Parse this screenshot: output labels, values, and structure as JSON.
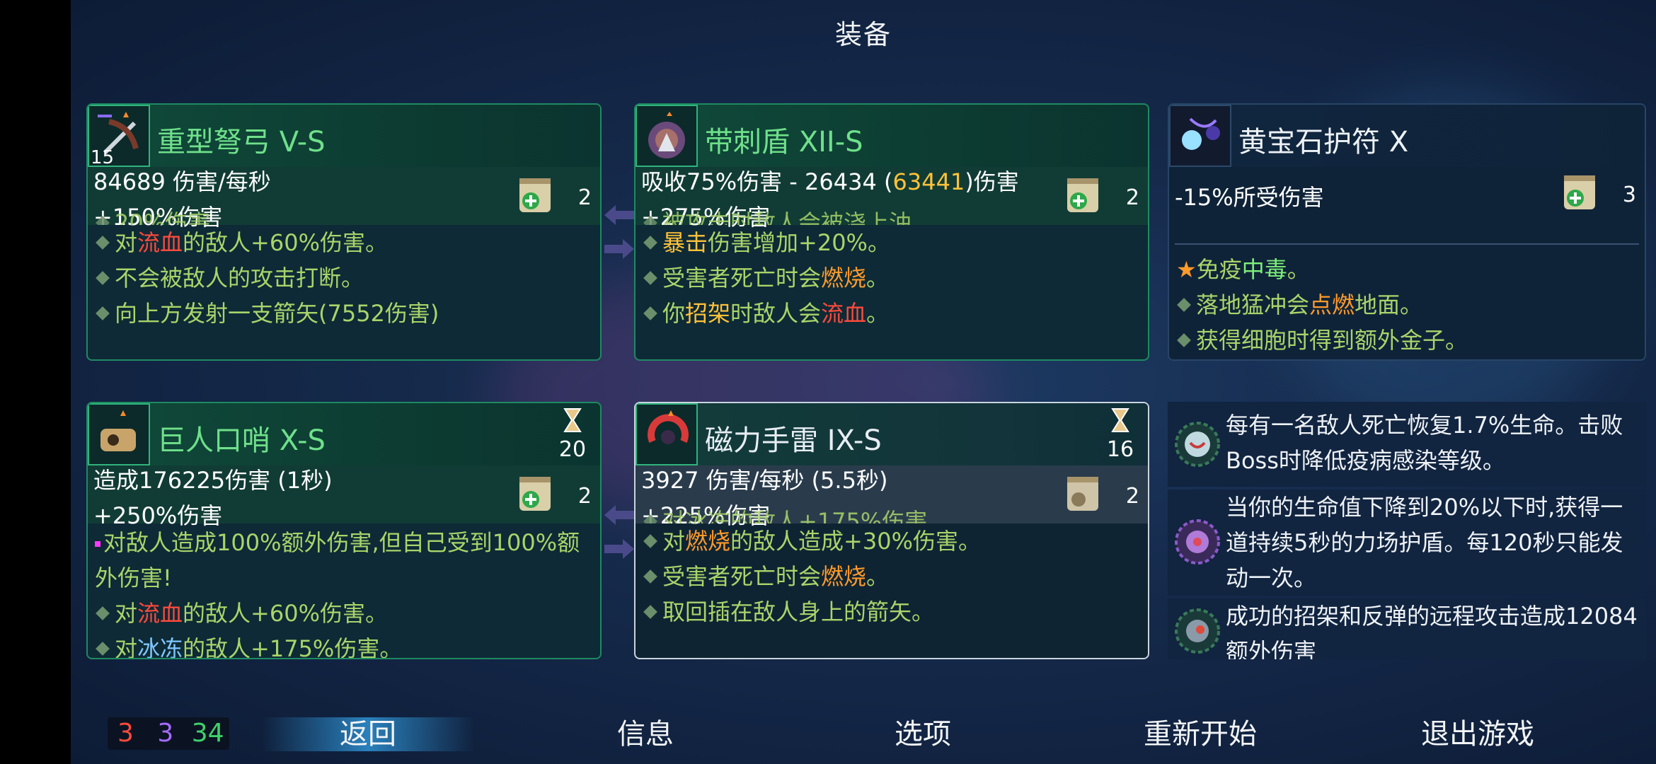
{
  "title": "装备",
  "weapons": [
    {
      "name": "重型弩弓 V-S",
      "level": "15",
      "line1": "84689 伤害/每秒",
      "line2": "+150%伤害",
      "scroll_count": "2",
      "cut_line": "20%伤害",
      "effects": [
        [
          {
            "t": "对"
          },
          {
            "t": "流血",
            "c": "r"
          },
          {
            "t": "的敌人+60%伤害。"
          }
        ],
        [
          {
            "t": "不会被敌人的攻击打断。"
          }
        ],
        [
          {
            "t": "向上方发射一支箭矢(7552伤害)"
          }
        ]
      ]
    },
    {
      "name": "带刺盾 XII-S",
      "line1_a": "吸收75%伤害 - 26434 (",
      "line1_b": "63441",
      "line1_c": ")伤害",
      "line2": "+275%伤害",
      "scroll_count": "2",
      "cut_line": "被攻击时敌人会被浇上油。",
      "effects": [
        [
          {
            "t": "暴击",
            "c": "y"
          },
          {
            "t": "伤害增加+20%。"
          }
        ],
        [
          {
            "t": "受害者死亡时会"
          },
          {
            "t": "燃烧",
            "c": "o"
          },
          {
            "t": "。"
          }
        ],
        [
          {
            "t": "你"
          },
          {
            "t": "招架",
            "c": "y"
          },
          {
            "t": "时敌人会"
          },
          {
            "t": "流血",
            "c": "r"
          },
          {
            "t": "。"
          }
        ]
      ]
    },
    {
      "name": "巨人口哨 X-S",
      "timer": "20",
      "line1": "造成176225伤害 (1秒)",
      "line2": "+250%伤害",
      "scroll_count": "2",
      "effects": [
        [
          {
            "t": "对敌人造成100%额外伤害,但自己受到100%额外伤害!"
          }
        ],
        [
          {
            "t": "对"
          },
          {
            "t": "流血",
            "c": "r"
          },
          {
            "t": "的敌人+60%伤害。"
          }
        ],
        [
          {
            "t": "对"
          },
          {
            "t": "冰冻",
            "c": "c"
          },
          {
            "t": "的敌人+175%伤害。"
          }
        ]
      ]
    },
    {
      "name": "磁力手雷 IX-S",
      "timer": "16",
      "line1": "3927 伤害/每秒 (5.5秒)",
      "line2": "+225%伤害",
      "scroll_count": "2",
      "cut_line": "对冰冻的敌人+175%伤害。",
      "effects": [
        [
          {
            "t": "对"
          },
          {
            "t": "燃烧",
            "c": "o"
          },
          {
            "t": "的敌人造成+30%伤害。"
          }
        ],
        [
          {
            "t": "受害者死亡时会"
          },
          {
            "t": "燃烧",
            "c": "o"
          },
          {
            "t": "。"
          }
        ],
        [
          {
            "t": "取回插在敌人身上的箭矢。"
          }
        ]
      ]
    }
  ],
  "amulet": {
    "name": "黄宝石护符 X",
    "line1": "-15%所受伤害",
    "scroll_count": "3",
    "effects": [
      [
        {
          "t": "免疫"
        },
        {
          "t": "中毒",
          "c": "g"
        },
        {
          "t": "。"
        }
      ],
      [
        {
          "t": "落地猛冲会"
        },
        {
          "t": "点燃",
          "c": "o"
        },
        {
          "t": "地面。"
        }
      ],
      [
        {
          "t": "获得细胞时得到额外金子。"
        }
      ]
    ]
  },
  "mutations": [
    {
      "text": "每有一名敌人死亡恢复1.7%生命。击败Boss时降低疫病感染等级。"
    },
    {
      "text": "当你的生命值下降到20%以下时,获得一道持续5秒的力场护盾。每120秒只能发动一次。"
    },
    {
      "text": "成功的招架和反弹的远程攻击造成12084额外伤害"
    }
  ],
  "stats": {
    "brutality": "3",
    "tactics": "3",
    "survival": "34"
  },
  "nav": {
    "back": "返回",
    "info": "信息",
    "options": "选项",
    "restart": "重新开始",
    "quit": "退出游戏"
  },
  "colors": {
    "brutality": "#ff3b3b",
    "tactics": "#a66bff",
    "survival": "#3fd26a",
    "accent_green": "#6fe08a"
  }
}
